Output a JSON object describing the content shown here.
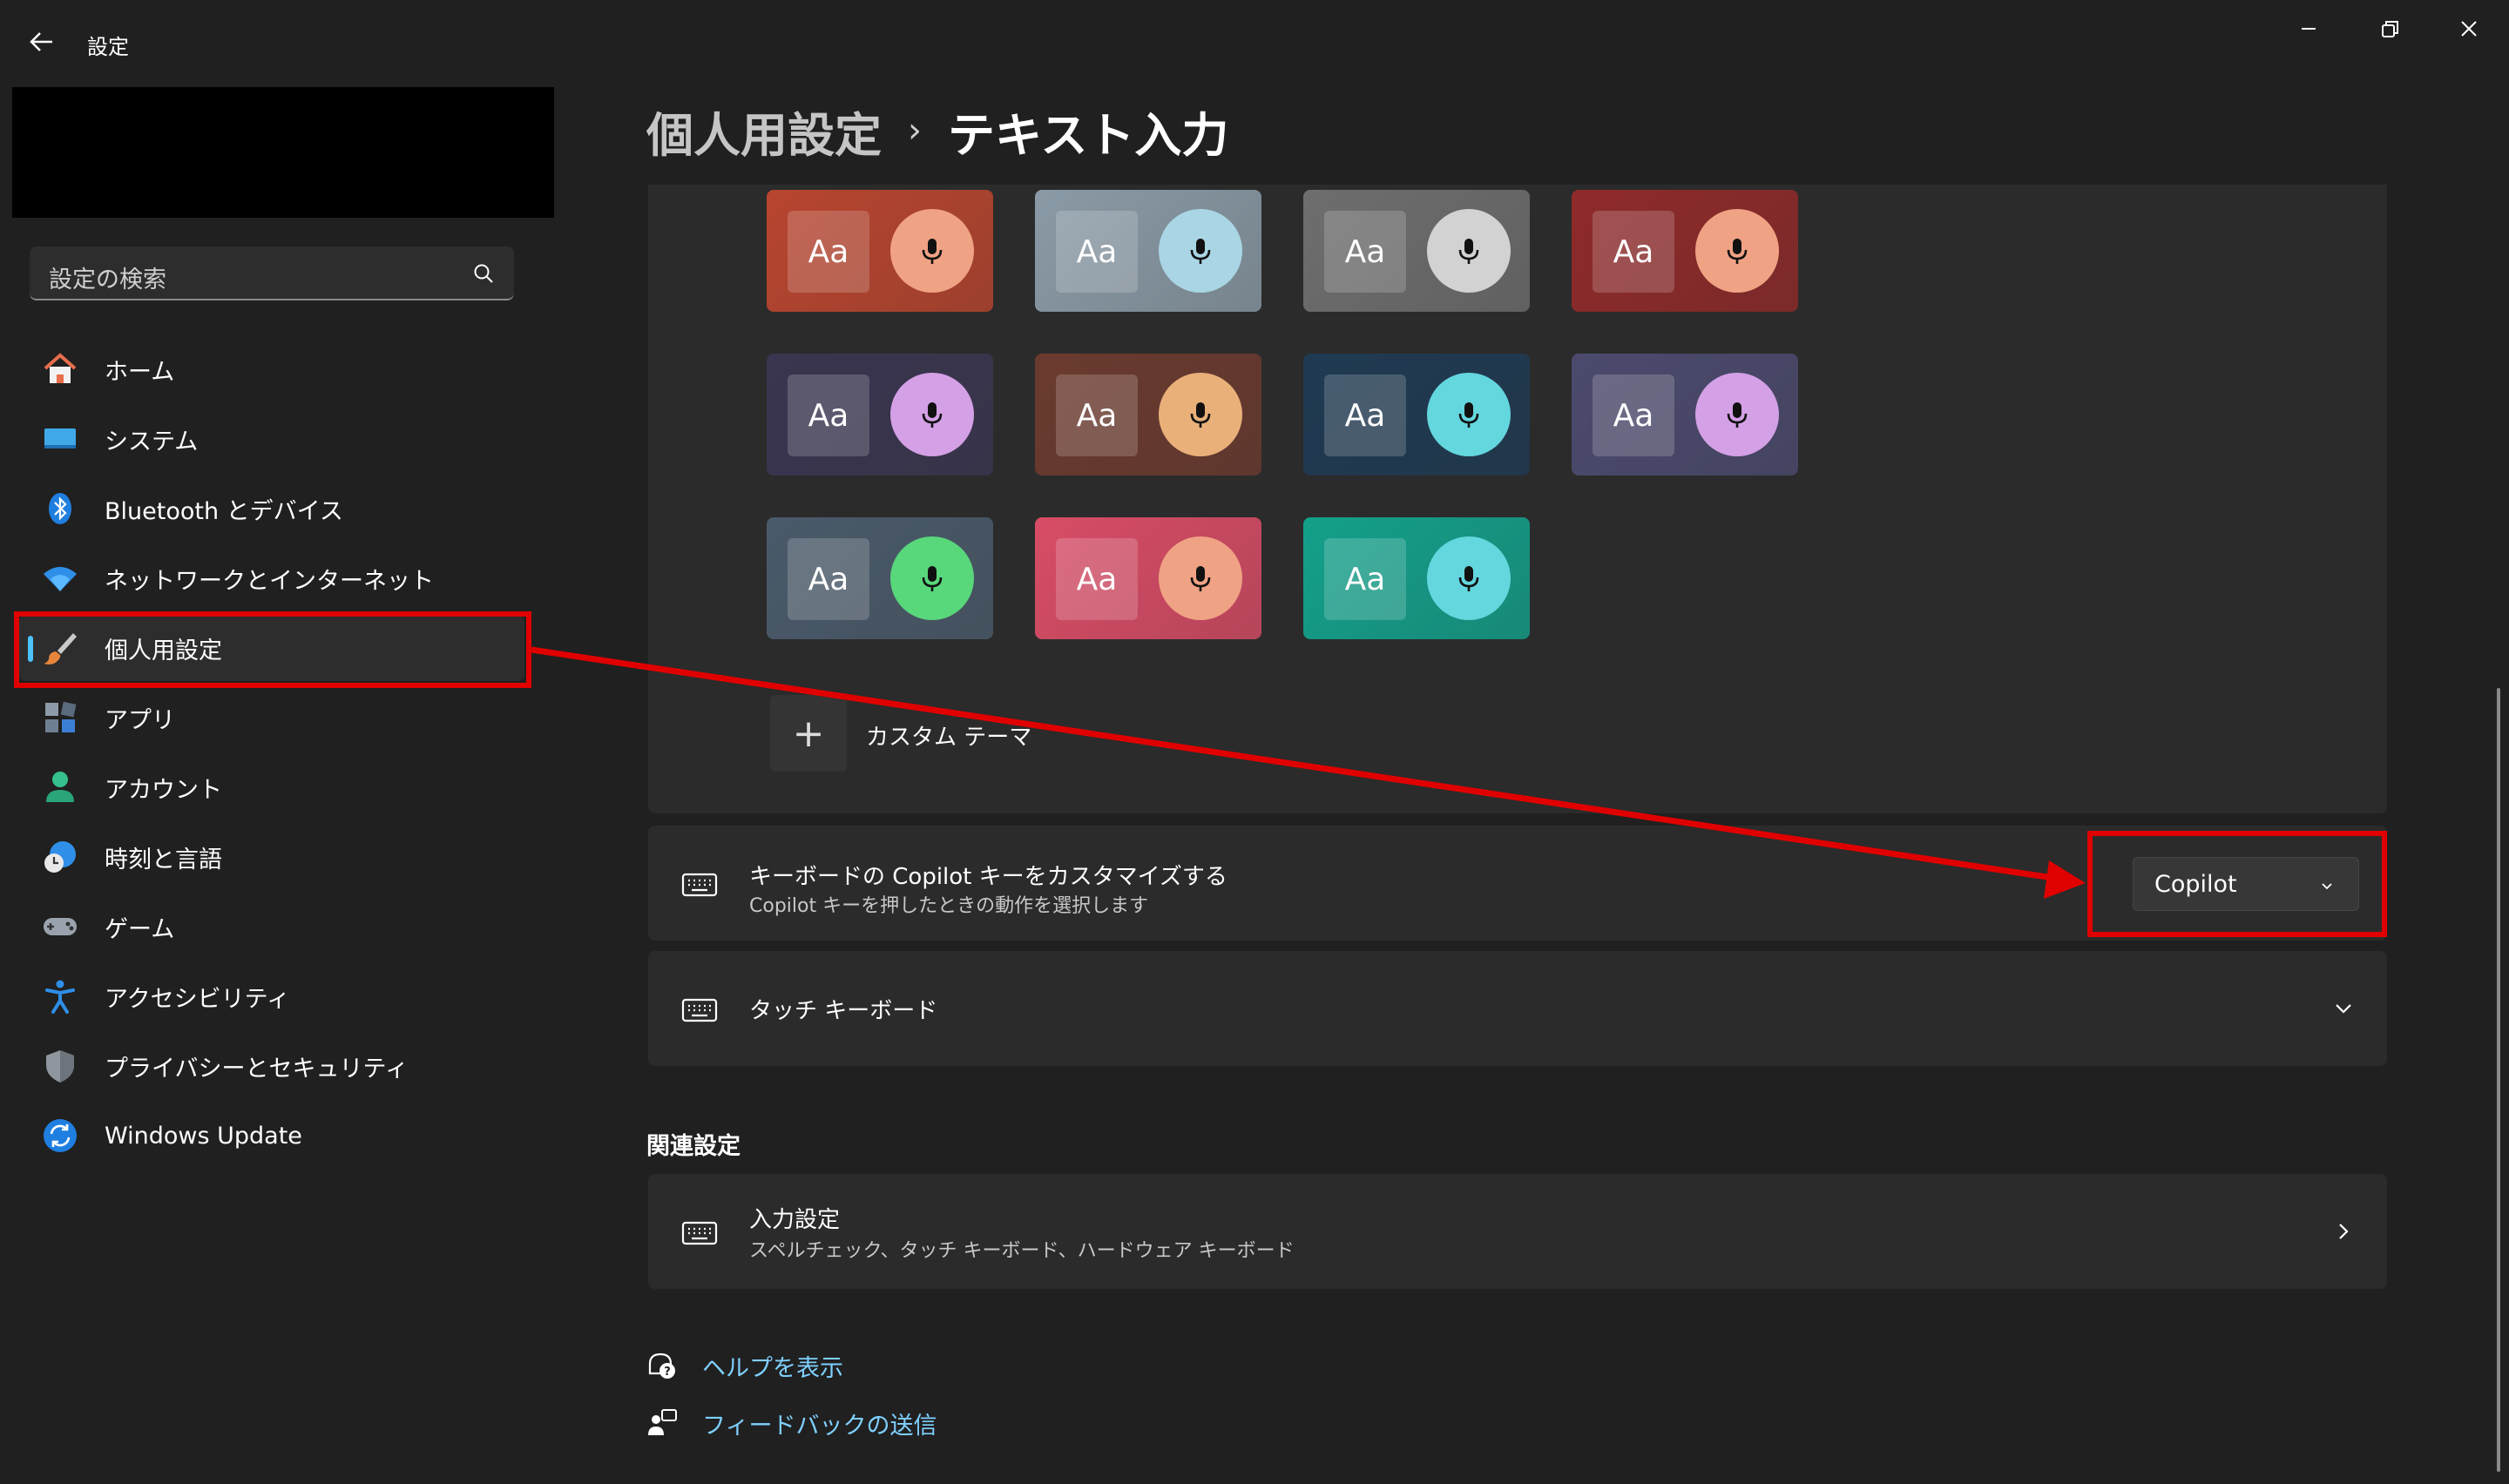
{
  "app": {
    "title": "設定"
  },
  "search": {
    "placeholder": "設定の検索"
  },
  "sidebar": {
    "items": [
      {
        "label": "ホーム",
        "icon": "home-icon"
      },
      {
        "label": "システム",
        "icon": "system-icon"
      },
      {
        "label": "Bluetooth とデバイス",
        "icon": "bluetooth-icon"
      },
      {
        "label": "ネットワークとインターネット",
        "icon": "wifi-icon"
      },
      {
        "label": "個人用設定",
        "icon": "brush-icon",
        "active": true
      },
      {
        "label": "アプリ",
        "icon": "apps-icon"
      },
      {
        "label": "アカウント",
        "icon": "account-icon"
      },
      {
        "label": "時刻と言語",
        "icon": "time-language-icon"
      },
      {
        "label": "ゲーム",
        "icon": "gamepad-icon"
      },
      {
        "label": "アクセシビリティ",
        "icon": "accessibility-icon"
      },
      {
        "label": "プライバシーとセキュリティ",
        "icon": "shield-icon"
      },
      {
        "label": "Windows Update",
        "icon": "update-icon"
      }
    ]
  },
  "header": {
    "breadcrumb_parent": "個人用設定",
    "breadcrumb_separator": "›",
    "breadcrumb_current": "テキスト入力"
  },
  "themes": {
    "tile_text": "Aa",
    "tiles": [
      {
        "bg": "#b8452f",
        "mic": "#f0a284"
      },
      {
        "bg": "#8a9aa6",
        "mic": "#a9d5e4"
      },
      {
        "bg": "#6e6e6e",
        "mic": "#d2d2d2"
      },
      {
        "bg": "#8f2a2a",
        "mic": "#f0a284"
      },
      {
        "bg": "#3a3550",
        "mic": "#d4a0e6"
      },
      {
        "bg": "#6b3a2e",
        "mic": "#e9b07a"
      },
      {
        "bg": "#1f3a52",
        "mic": "#63d6de"
      },
      {
        "bg": "#4b4a6e",
        "mic": "#d4a0e6"
      },
      {
        "bg": "#4a5a6a",
        "mic": "#58d77b"
      },
      {
        "bg": "#d84c66",
        "mic": "#f0a284"
      },
      {
        "bg": "#13a08b",
        "mic": "#63d6de"
      }
    ],
    "custom_label": "カスタム テーマ",
    "custom_plus": "+"
  },
  "copilot_card": {
    "title": "キーボードの Copilot キーをカスタマイズする",
    "subtitle": "Copilot キーを押したときの動作を選択します",
    "dropdown_value": "Copilot"
  },
  "touch_card": {
    "title": "タッチ キーボード"
  },
  "related": {
    "section_title": "関連設定",
    "input_title": "入力設定",
    "input_subtitle": "スペルチェック、タッチ キーボード、ハードウェア キーボード"
  },
  "links": {
    "help": "ヘルプを表示",
    "feedback": "フィードバックの送信"
  },
  "colors": {
    "accent": "#4cc2ff",
    "annotation": "#e00000"
  }
}
